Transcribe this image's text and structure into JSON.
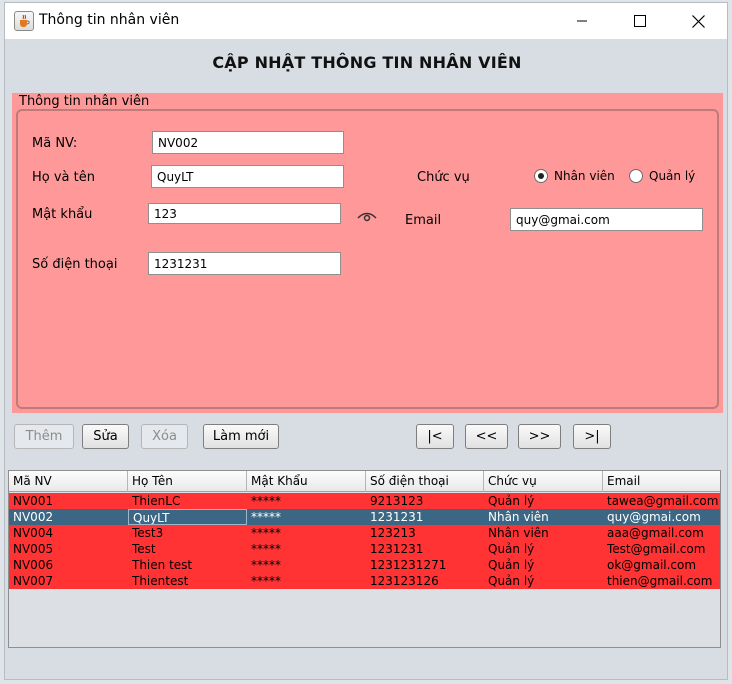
{
  "window": {
    "title": "Thông tin nhân viên"
  },
  "header": {
    "title": "CẬP NHẬT THÔNG TIN NHÂN VIÊN"
  },
  "form": {
    "panel_title": "Thông tin nhân viên",
    "ma_nv_label": "Mã NV:",
    "ma_nv_value": "NV002",
    "ho_ten_label": "Họ và tên",
    "ho_ten_value": "QuyLT",
    "mat_khau_label": "Mật khẩu",
    "mat_khau_value": "123",
    "sdt_label": "Số điện thoại",
    "sdt_value": "1231231",
    "chuc_vu_label": "Chức vụ",
    "radio_nhan_vien": "Nhân viên",
    "radio_quan_ly": "Quản lý",
    "selected_role": "Nhân viên",
    "email_label": "Email",
    "email_value": "quy@gmai.com",
    "panel_color": "#ff9999"
  },
  "buttons": {
    "them": "Thêm",
    "sua": "Sửa",
    "xoa": "Xóa",
    "lam_moi": "Làm mới",
    "first": "|<",
    "prev": "<<",
    "next": ">>",
    "last": ">|"
  },
  "table": {
    "columns": [
      "Mã NV",
      "Họ Tên",
      "Mật Khẩu",
      "Số điện thoại",
      "Chức vụ",
      "Email"
    ],
    "rows": [
      [
        "NV001",
        "ThienLC",
        "*****",
        "9213123",
        "Quản lý",
        "tawea@gmail.com"
      ],
      [
        "NV002",
        "QuyLT",
        "*****",
        "1231231",
        "Nhân viên",
        "quy@gmai.com"
      ],
      [
        "NV004",
        "Test3",
        "*****",
        "123213",
        "Nhân viên",
        "aaa@gmail.com"
      ],
      [
        "NV005",
        "Test",
        "*****",
        "1231231",
        "Quản lý",
        "Test@gmail.com"
      ],
      [
        "NV006",
        "Thien test",
        "*****",
        "1231231271",
        "Quản lý",
        "ok@gmail.com"
      ],
      [
        "NV007",
        "Thientest",
        "*****",
        "123123126",
        "Quản lý",
        "thien@gmail.com"
      ]
    ],
    "selected_row": 1,
    "row_color": "#ff3333",
    "selected_color": "#3b6784"
  },
  "icons": {
    "app": "java-cup-icon",
    "minimize": "minimize-icon",
    "maximize": "maximize-icon",
    "close": "close-icon",
    "show_password": "eye-icon"
  }
}
